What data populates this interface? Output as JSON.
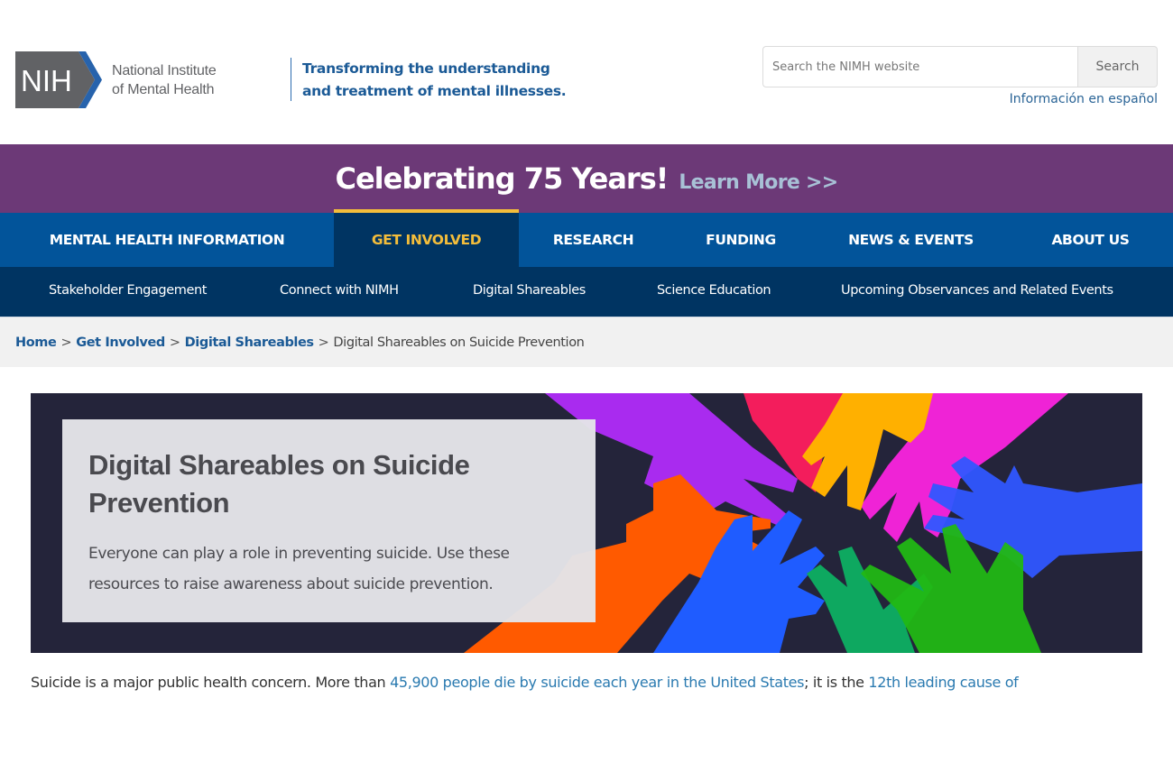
{
  "header": {
    "logo": {
      "mark": "NIH",
      "line1": "National Institute",
      "line2": "of Mental Health"
    },
    "tagline": {
      "line1": "Transforming the understanding",
      "line2": "and treatment of mental illnesses."
    },
    "search": {
      "placeholder": "Search the NIMH website",
      "value": "",
      "button_label": "Search"
    },
    "spanish_link": "Información en español"
  },
  "banner": {
    "title": "Celebrating 75 Years!",
    "link": "Learn More >>"
  },
  "main_nav": {
    "items": [
      {
        "label": "MENTAL HEALTH INFORMATION",
        "active": false
      },
      {
        "label": "GET INVOLVED",
        "active": true
      },
      {
        "label": "RESEARCH",
        "active": false
      },
      {
        "label": "FUNDING",
        "active": false
      },
      {
        "label": "NEWS & EVENTS",
        "active": false
      },
      {
        "label": "ABOUT US",
        "active": false
      }
    ]
  },
  "sub_nav": {
    "items": [
      {
        "label": "Stakeholder Engagement"
      },
      {
        "label": "Connect with NIMH"
      },
      {
        "label": "Digital Shareables"
      },
      {
        "label": "Science Education"
      },
      {
        "label": "Upcoming Observances and Related Events"
      }
    ]
  },
  "breadcrumb": {
    "items": [
      {
        "label": "Home"
      },
      {
        "label": "Get Involved"
      },
      {
        "label": "Digital Shareables"
      }
    ],
    "separator": ">",
    "current": "Digital Shareables on Suicide Prevention"
  },
  "hero": {
    "title": "Digital Shareables on Suicide Prevention",
    "description": "Everyone can play a role in preventing suicide. Use these resources to raise awareness about suicide prevention.",
    "image_alt": "colorful-hands-reaching-in-circle"
  },
  "intro": {
    "text_1": "Suicide is a major public health concern. More than ",
    "link_1": "45,900 people die by suicide each year in the United States",
    "text_2": "; it is the ",
    "link_2": "12th leading cause of"
  },
  "colors": {
    "banner_purple": "#6c3977",
    "nav_blue": "#02549a",
    "nav_dark": "#003462",
    "active_gold": "#f3bd3b",
    "link_blue": "#2a7ab0",
    "hero_bg": "#24243a"
  }
}
